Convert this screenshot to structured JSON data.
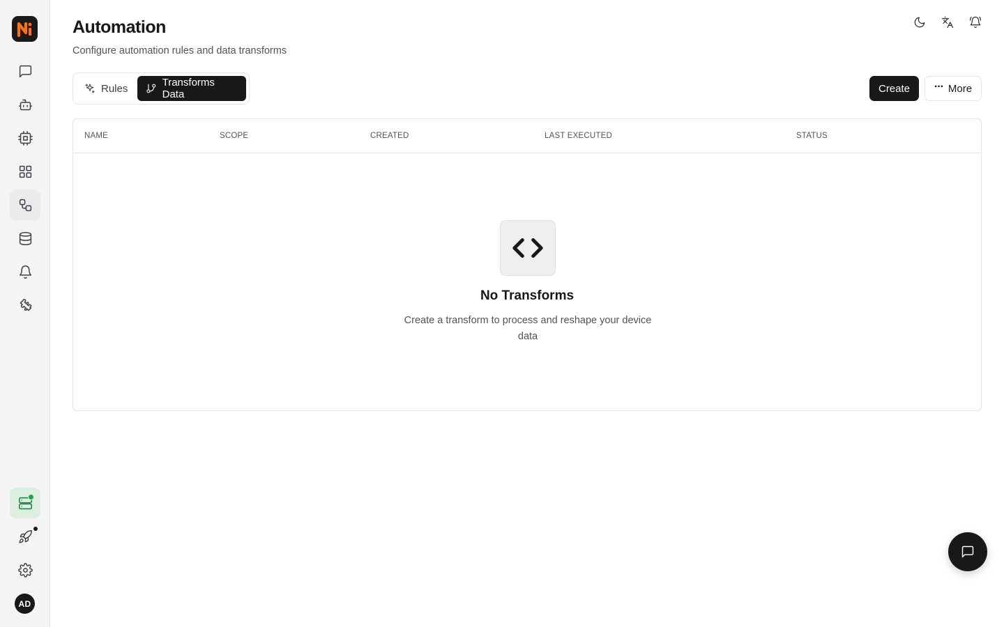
{
  "app": {
    "logo_icon": "brand-logo-icon",
    "accent_color": "#f97316",
    "user_initials": "AD"
  },
  "sidebar": {
    "items": [
      {
        "name": "chat",
        "icon": "message-square-icon"
      },
      {
        "name": "agents",
        "icon": "bot-icon"
      },
      {
        "name": "devices",
        "icon": "cpu-icon"
      },
      {
        "name": "dashboards",
        "icon": "layout-grid-icon"
      },
      {
        "name": "automation",
        "icon": "workflow-icon",
        "active": true
      },
      {
        "name": "data",
        "icon": "database-icon"
      },
      {
        "name": "alerts",
        "icon": "bell-icon"
      },
      {
        "name": "extensions",
        "icon": "puzzle-icon"
      }
    ],
    "bottom": [
      {
        "name": "system-status",
        "icon": "server-status-icon",
        "status_color": "#22a34a"
      },
      {
        "name": "getting-started",
        "icon": "rocket-icon"
      },
      {
        "name": "settings",
        "icon": "gear-icon"
      }
    ]
  },
  "header": {
    "title": "Automation",
    "subtitle": "Configure automation rules and data transforms",
    "icons": [
      "moon-icon",
      "translate-icon",
      "bell-icon"
    ]
  },
  "tabs": [
    {
      "label": "Rules",
      "icon": "sparkles-icon",
      "selected": false
    },
    {
      "label": "Transforms Data",
      "icon": "git-branch-icon",
      "selected": true
    }
  ],
  "actions": {
    "create_label": "Create",
    "more_label": "More"
  },
  "table": {
    "columns": [
      "NAME",
      "SCOPE",
      "CREATED",
      "LAST EXECUTED",
      "STATUS"
    ],
    "rows": [],
    "empty": {
      "icon": "code-icon",
      "title": "No Transforms",
      "description": "Create a transform to process and reshape your device data"
    }
  },
  "chat_fab": {
    "icon": "message-square-icon"
  }
}
